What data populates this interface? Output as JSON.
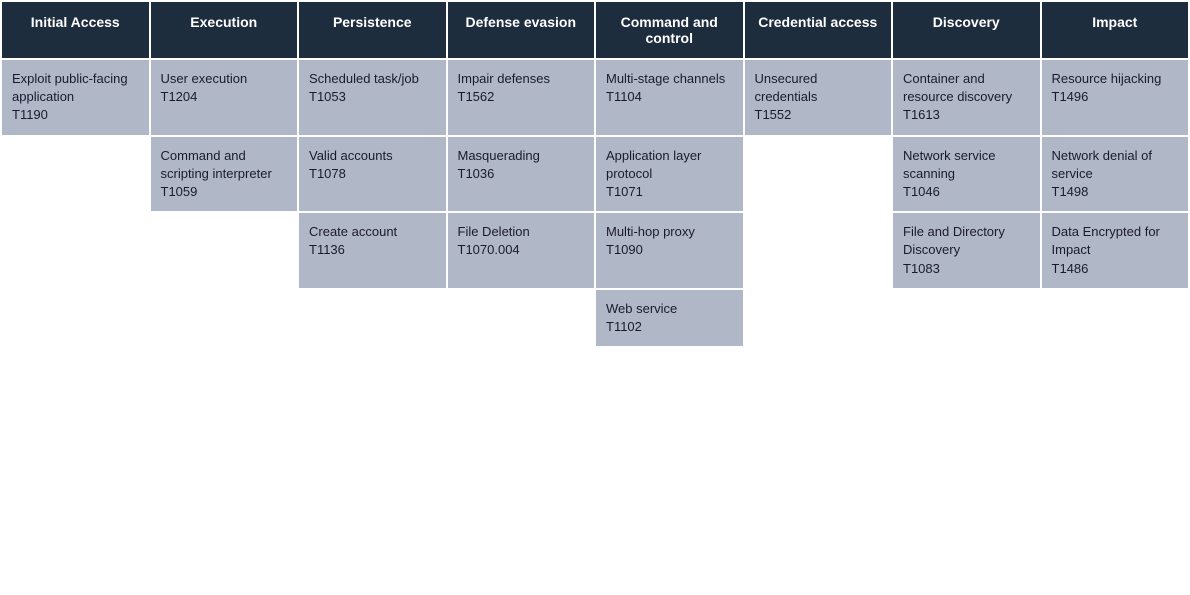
{
  "columns": [
    {
      "header": "Initial Access",
      "cells": [
        {
          "name": "Exploit public-facing application",
          "id": "T1190"
        },
        {
          "name": "",
          "id": ""
        },
        {
          "name": "",
          "id": ""
        }
      ]
    },
    {
      "header": "Execution",
      "cells": [
        {
          "name": "User execution",
          "id": "T1204"
        },
        {
          "name": "Command and scripting interpreter",
          "id": "T1059"
        },
        {
          "name": "",
          "id": ""
        }
      ]
    },
    {
      "header": "Persistence",
      "cells": [
        {
          "name": "Scheduled task/job",
          "id": "T1053"
        },
        {
          "name": "Valid accounts",
          "id": "T1078"
        },
        {
          "name": "Create account",
          "id": "T1136"
        }
      ]
    },
    {
      "header": "Defense evasion",
      "cells": [
        {
          "name": "Impair defenses",
          "id": "T1562"
        },
        {
          "name": "Masquerading",
          "id": "T1036"
        },
        {
          "name": "File Deletion",
          "id": "T1070.004"
        }
      ]
    },
    {
      "header": "Command and control",
      "cells": [
        {
          "name": "Multi-stage channels",
          "id": "T1104"
        },
        {
          "name": "Application layer protocol",
          "id": "T1071"
        },
        {
          "name": "Multi-hop proxy",
          "id": "T1090"
        },
        {
          "name": "Web service",
          "id": "T1102"
        }
      ]
    },
    {
      "header": "Credential access",
      "cells": [
        {
          "name": "Unsecured credentials",
          "id": "T1552"
        },
        {
          "name": "",
          "id": ""
        },
        {
          "name": "",
          "id": ""
        }
      ]
    },
    {
      "header": "Discovery",
      "cells": [
        {
          "name": "Container and resource discovery",
          "id": "T1613"
        },
        {
          "name": "Network service scanning",
          "id": "T1046"
        },
        {
          "name": "File and Directory Discovery",
          "id": "T1083"
        }
      ]
    },
    {
      "header": "Impact",
      "cells": [
        {
          "name": "Resource hijacking",
          "id": "T1496"
        },
        {
          "name": "Network denial of service",
          "id": "T1498"
        },
        {
          "name": "Data Encrypted for Impact",
          "id": "T1486"
        }
      ]
    }
  ]
}
